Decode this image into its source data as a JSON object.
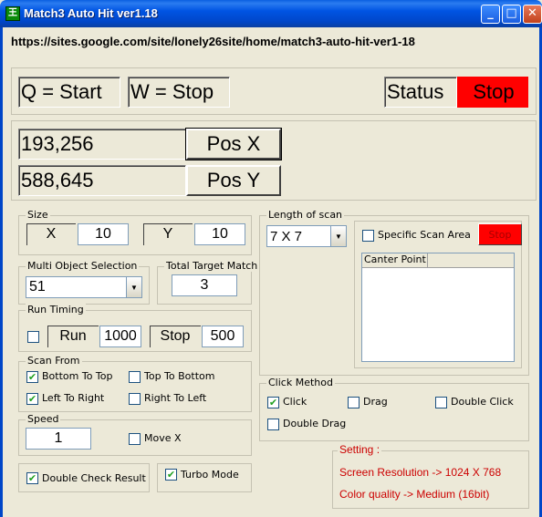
{
  "window": {
    "title": "Match3 Auto Hit ver1.18",
    "app_icon_glyph": "王",
    "min_glyph": "_",
    "max_glyph": "□",
    "close_glyph": "✕"
  },
  "url": "https://sites.google.com/site/lonely26site/home/match3-auto-hit-ver1-18",
  "hotkeys": {
    "start": "Q = Start",
    "stop": "W = Stop"
  },
  "status": {
    "label": "Status",
    "value": "Stop",
    "value_color": "#ff0000"
  },
  "position": {
    "x_value": "193,256",
    "x_button": "Pos X",
    "y_value": "588,645",
    "y_button": "Pos Y"
  },
  "size": {
    "group": "Size",
    "x_label": "X",
    "x_value": "10",
    "y_label": "Y",
    "y_value": "10"
  },
  "multi_object": {
    "group": "Multi Object Selection",
    "value": "51"
  },
  "total_target": {
    "group": "Total Target Match",
    "value": "3"
  },
  "run_timing": {
    "group": "Run Timing",
    "checked": false,
    "run_label": "Run",
    "run_value": "1000",
    "stop_label": "Stop",
    "stop_value": "500"
  },
  "scan_from": {
    "group": "Scan From",
    "bottom_to_top": "Bottom To Top",
    "top_to_bottom": "Top To Bottom",
    "left_to_right": "Left To Right",
    "right_to_left": "Right To Left",
    "checked_mark": "✔"
  },
  "speed": {
    "group": "Speed",
    "value": "1",
    "move_x": "Move X"
  },
  "double_check": "Double Check Result",
  "turbo_mode": "Turbo Mode",
  "length_of_scan": {
    "group": "Length of scan",
    "value": "7 X 7",
    "specific_area": "Specific Scan Area",
    "stop_button": "Stop",
    "list_header": "Canter Point"
  },
  "click_method": {
    "group": "Click Method",
    "click": "Click",
    "drag": "Drag",
    "double_click": "Double Click",
    "double_drag": "Double Drag"
  },
  "setting": {
    "group": "Setting :",
    "resolution": "Screen Resolution -> 1024 X 768",
    "color_quality": "Color quality -> Medium (16bit)"
  }
}
